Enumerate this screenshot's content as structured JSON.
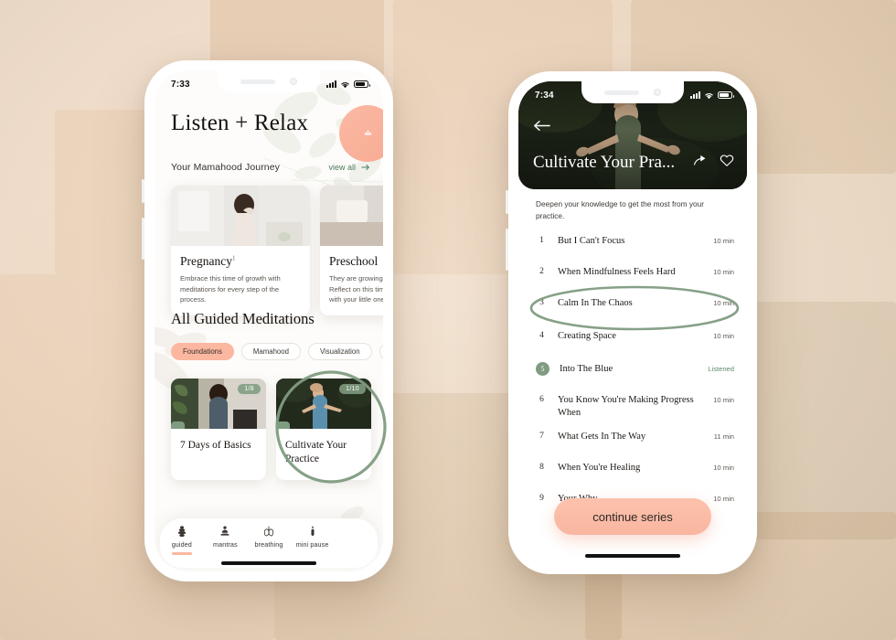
{
  "background": {
    "base_color": "#f0ddc8",
    "accent_peach": "#fbb7a0",
    "accent_green": "#7f9c81"
  },
  "left_phone": {
    "status_bar": {
      "time": "7:33",
      "signal_icon": "signal-bars-icon",
      "wifi_icon": "wifi-icon",
      "battery_icon": "battery-icon"
    },
    "header": {
      "title": "Listen + Relax",
      "circle_button_icon": "lotus-icon"
    },
    "section": {
      "label": "Your Mamahood Journey",
      "view_all": "view all",
      "arrow_icon": "arrow-right-icon"
    },
    "journey_cards": [
      {
        "title": "Pregnancy",
        "sup": "1",
        "desc": "Embrace this time of growth with meditations for every step of the process."
      },
      {
        "title": "Preschool",
        "sup": "",
        "desc": "They are growing up so fast, Mama. Reflect on this time and be present with your little one."
      }
    ],
    "all_meditations_title": "All Guided Meditations",
    "chips": [
      {
        "label": "Foundations",
        "active": true
      },
      {
        "label": "Mamahood",
        "active": false
      },
      {
        "label": "Visualization",
        "active": false
      },
      {
        "label": "M",
        "active": false
      }
    ],
    "meditation_cards": [
      {
        "title": "7 Days of Basics",
        "progress": "1/8"
      },
      {
        "title": "Cultivate Your Practice",
        "progress": "1/10"
      }
    ],
    "tabbar": [
      {
        "label": "guided",
        "icon": "stacked-stones-icon",
        "active": true
      },
      {
        "label": "mantras",
        "icon": "meditating-figure-icon",
        "active": false
      },
      {
        "label": "breathing",
        "icon": "lungs-icon",
        "active": false
      },
      {
        "label": "mini pause",
        "icon": "candle-icon",
        "active": false
      }
    ]
  },
  "right_phone": {
    "status_bar": {
      "time": "7:34",
      "signal_icon": "signal-bars-icon",
      "wifi_icon": "wifi-icon",
      "battery_icon": "battery-icon"
    },
    "hero": {
      "back_icon": "arrow-left-icon",
      "title": "Cultivate Your Pra...",
      "share_icon": "share-icon",
      "favorite_icon": "heart-icon"
    },
    "description": "Deepen your knowledge to get the most from your practice.",
    "tracks": [
      {
        "num": "1",
        "title": "But I Can't Focus",
        "meta": "10 min",
        "listened": false
      },
      {
        "num": "2",
        "title": "When Mindfulness Feels Hard",
        "meta": "10 min",
        "listened": false
      },
      {
        "num": "3",
        "title": "Calm In The Chaos",
        "meta": "10 min",
        "listened": false
      },
      {
        "num": "4",
        "title": "Creating Space",
        "meta": "10 min",
        "listened": false
      },
      {
        "num": "5",
        "title": "Into The Blue",
        "meta": "Listened",
        "listened": true
      },
      {
        "num": "6",
        "title": "You Know You're Making Progress When",
        "meta": "10 min",
        "listened": false
      },
      {
        "num": "7",
        "title": "What Gets In The Way",
        "meta": "11 min",
        "listened": false
      },
      {
        "num": "8",
        "title": "When You're Healing",
        "meta": "10 min",
        "listened": false
      },
      {
        "num": "9",
        "title": "Your Why",
        "meta": "10 min",
        "listened": false
      }
    ],
    "cta_label": "continue series"
  },
  "annotations": [
    {
      "name": "cultivate-your-practice-highlight",
      "color": "#7f9c81"
    },
    {
      "name": "track-3-highlight",
      "color": "#7f9c81"
    }
  ]
}
